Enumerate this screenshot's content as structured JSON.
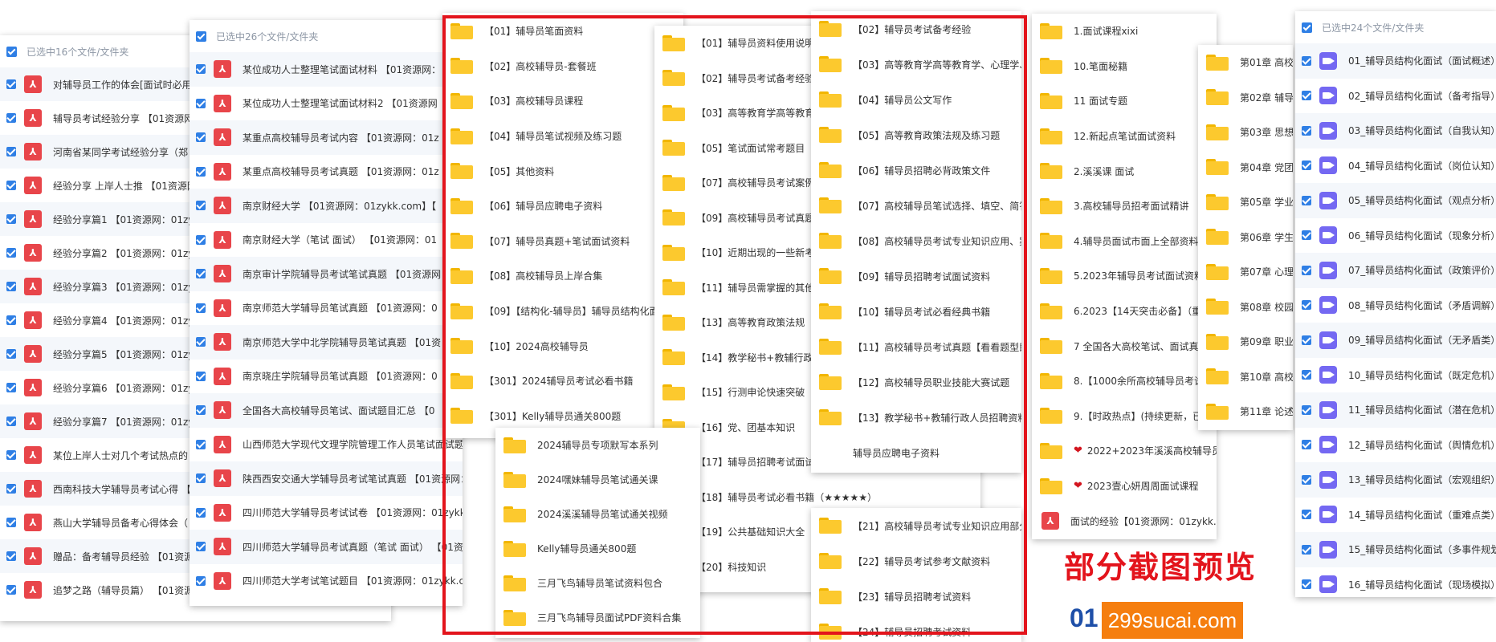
{
  "panel1": {
    "header": "已选中16个文件/文件夹",
    "items": [
      "对辅导员工作的体会[面试时必用",
      "辅导员考试经验分享 【01资源网",
      "河南省某同学考试经验分享（郑",
      "经验分享 上岸人士推 【01资源网",
      "经验分享篇1 【01资源网：01zy",
      "经验分享篇2 【01资源网：01zy",
      "经验分享篇3 【01资源网：01zy",
      "经验分享篇4 【01资源网：01zy",
      "经验分享篇5 【01资源网：01zy",
      "经验分享篇6 【01资源网：01zy",
      "经验分享篇7 【01资源网：01zy",
      "某位上岸人士对几个考试热点的",
      "西南科技大学辅导员考试心得 【",
      "燕山大学辅导员备考心得体会（",
      "赠品：备考辅导员经验 【01资源",
      "追梦之路（辅导员篇） 【01资源"
    ]
  },
  "panel2": {
    "header": "已选中26个文件/文件夹",
    "items": [
      "某位成功人士整理笔试面试材料 【01资源网：",
      "某位成功人士整理笔试面试材料2 【01资源网",
      "某重点高校辅导员考试内容 【01资源网：01z",
      "某重点高校辅导员考试真题 【01资源网：01z",
      "南京财经大学 【01资源网：01zykk.com】【",
      "南京财经大学（笔试 面试） 【01资源网：01",
      "南京审计学院辅导员考试笔试真题 【01资源网",
      "南京师范大学辅导员笔试真题 【01资源网：0",
      "南京师范大学中北学院辅导员笔试真题 【01资",
      "南京晓庄学院辅导员笔试真题 【01资源网：0",
      "全国各大高校辅导员笔试、面试题目汇总 【0",
      "山西师范大学现代文理学院管理工作人员笔试面试题 【01",
      "陕西西安交通大学辅导员考试笔试真题 【01资源网：01zy",
      "四川师范大学辅导员考试试卷 【01资源网：01zykk.com】",
      "四川师范大学辅导员考试真题（笔试 面试） 【01资源网：",
      "四川师范大学考试笔试题目 【01资源网：01zykk.com】"
    ]
  },
  "panel3": {
    "items": [
      "【01】辅导员笔面资料",
      "【02】高校辅导员-套餐班",
      "【03】高校辅导员课程",
      "【04】辅导员笔试视频及练习题",
      "【05】其他资料",
      "【06】辅导员应聘电子资料",
      "【07】辅导员真题+笔试面试资料",
      "【08】高校辅导员上岸合集",
      "【09】【结构化-辅导员】辅导员结构化面",
      "【10】2024高校辅导员",
      "【301】2024辅导员考试必看书籍",
      "【301】Kelly辅导员通关800题"
    ]
  },
  "panel4": {
    "items": [
      "2024辅导员专项默写本系列",
      "2024嘿妹辅导员笔试通关课",
      "2024溪溪辅导员笔试通关视频",
      "Kelly辅导员通关800题",
      "三月飞鸟辅导员笔试资料包合",
      "三月飞鸟辅导员面试PDF资料合集"
    ]
  },
  "panel5": {
    "items": [
      "【01】辅导员资料使用说明",
      "【02】辅导员考试备考经验",
      "【03】高等教育学高等教育",
      "【05】笔试面试常考题目（",
      "【07】高校辅导员考试案例",
      "【09】高校辅导员考试真题",
      "【10】近期出现的一些新考",
      "【11】辅导员需掌握的其他",
      "【13】高等教育政策法规",
      "【14】教学秘书+教辅行政人",
      "【15】行测申论快速突破（",
      "【16】党、团基本知识",
      "【17】辅导员招聘考试面试",
      "【18】辅导员考试必看书籍（★★★★★）",
      "【19】公共基础知识大全",
      "【20】科技知识"
    ]
  },
  "panel6": {
    "items": [
      "【02】辅导员考试备考经验",
      "【03】高等教育学高等教育学、心理学、",
      "【04】辅导员公文写作",
      "【05】高等教育政策法规及练习题",
      "【06】辅导员招聘必背政策文件",
      "【07】高校辅导员笔试选择、填空、简答",
      "【08】高校辅导员考试专业知识应用、案例",
      "【09】辅导员招聘考试面试资料",
      "【10】辅导员考试必看经典书籍",
      "【11】高校辅导员考试真题【看看题型即可",
      "【12】高校辅导员职业技能大赛试题",
      "【13】教学秘书+教辅行政人员招聘资料",
      "辅导员应聘电子资料"
    ]
  },
  "panel7": {
    "items": [
      "【21】高校辅导员考试专业知识应用部分",
      "【22】辅导员考试参考文献资料",
      "【23】辅导员招聘考试资料",
      "【24】辅导员招聘考试资料"
    ]
  },
  "panel8": {
    "items": [
      "1.面试课程xixi",
      "10.笔面秘籍",
      "11 面试专题",
      "12.新起点笔试面试资料",
      "2.溪溪课 面试",
      "3.高校辅导员招考面试精讲",
      "4.辅导员面试市面上全部资料，在",
      "5.2023年辅导员考试面试资料",
      "6.2023【14天突击必备】（重点",
      "7 全国各大高校笔试、面试真题",
      "8.【1000余所高校辅导员考试真题",
      "9.【时政热点】(持续更新，已更",
      "2022+2023年溪溪高校辅导员面试资料",
      "2023壹心妍周周面试课程",
      "面试的经验【01资源网：01zykk.com】【微信号：xue63"
    ]
  },
  "panel9": {
    "items": [
      "第01章 高校辅",
      "第02章 辅导员",
      "第03章 思想政",
      "第04章 党团和",
      "第05章 学业指",
      "第06章 学生日",
      "第07章 心理健",
      "第08章 校园危",
      "第09章 职业生",
      "第10章 高校辅",
      "第11章 论述与"
    ]
  },
  "panel10": {
    "header": "已选中24个文件/文件夹",
    "items": [
      "01_辅导员结构化面试（面试概述）",
      "02_辅导员结构化面试（备考指导）",
      "03_辅导员结构化面试（自我认知）",
      "04_辅导员结构化面试（岗位认知）",
      "05_辅导员结构化面试（观点分析）",
      "06_辅导员结构化面试（现象分析）",
      "07_辅导员结构化面试（政策评价）",
      "08_辅导员结构化面试（矛盾调解）",
      "09_辅导员结构化面试（无矛盾类）",
      "10_辅导员结构化面试（既定危机）",
      "11_辅导员结构化面试（潜在危机）",
      "12_辅导员结构化面试（舆情危机）",
      "13_辅导员结构化面试（宏观组织）",
      "14_辅导员结构化面试（重难点类）",
      "15_辅导员结构化面试（多事件规划）",
      "16_辅导员结构化面试（现场模拟）"
    ]
  },
  "caption": "部分截图预览",
  "logo": {
    "prefix": "01",
    "domain": "299sucai.com"
  },
  "colors": {
    "frame": "#e3141c",
    "checkbox": "#2f7fe5",
    "pdf": "#e8454a",
    "folder": "#fcc92e",
    "video": "#7468f2",
    "logo_bg": "#f57e0f"
  }
}
